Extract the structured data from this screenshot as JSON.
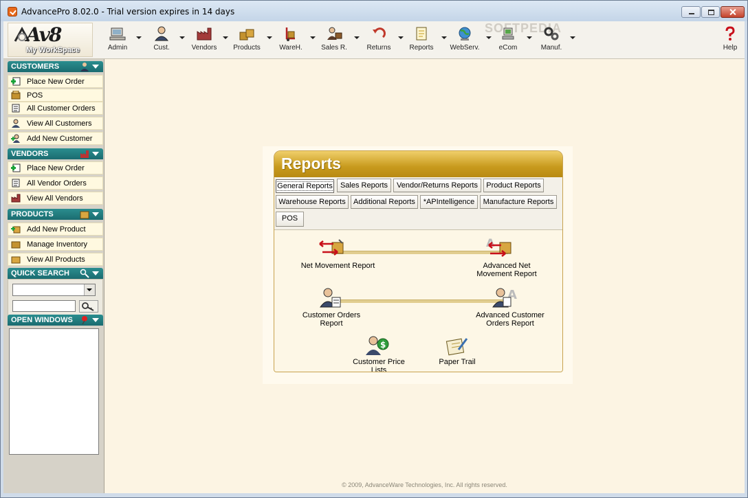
{
  "window": {
    "title": "AdvancePro 8.02.0 - Trial version expires in 14 days"
  },
  "logo": {
    "mark": "Av8",
    "subtitle": "My WorkSpace"
  },
  "toolbar": {
    "items": [
      {
        "label": "Admin",
        "icon": "admin-computer-icon"
      },
      {
        "label": "Cust.",
        "icon": "customer-person-icon"
      },
      {
        "label": "Vendors",
        "icon": "vendors-factory-icon"
      },
      {
        "label": "Products",
        "icon": "products-boxes-icon"
      },
      {
        "label": "WareH.",
        "icon": "warehouse-handtruck-icon"
      },
      {
        "label": "Sales R.",
        "icon": "sales-rep-icon"
      },
      {
        "label": "Returns",
        "icon": "returns-arrow-icon"
      },
      {
        "label": "Reports",
        "icon": "reports-document-icon"
      },
      {
        "label": "WebServ.",
        "icon": "webserv-globe-icon"
      },
      {
        "label": "eCom",
        "icon": "ecom-cart-icon"
      },
      {
        "label": "Manuf.",
        "icon": "manufacture-gears-icon"
      }
    ],
    "help_label": "Help",
    "watermark": "SOFTPEDIA"
  },
  "sidebar": {
    "customers": {
      "header": "CUSTOMERS",
      "items": [
        "Place New Order",
        "POS",
        "All Customer Orders",
        "View All Customers",
        "Add New Customer"
      ]
    },
    "vendors": {
      "header": "VENDORS",
      "items": [
        "Place New Order",
        "All Vendor Orders",
        "View All Vendors"
      ]
    },
    "products": {
      "header": "PRODUCTS",
      "items": [
        "Add New Product",
        "Manage Inventory",
        "View All Products"
      ]
    },
    "quick_search": {
      "header": "QUICK SEARCH",
      "select_value": "",
      "input_value": ""
    },
    "open_windows": {
      "header": "OPEN WINDOWS"
    }
  },
  "reports": {
    "title": "Reports",
    "tabs_row1": [
      "General Reports",
      "Sales Reports",
      "Vendor/Returns Reports",
      "Product Reports"
    ],
    "tabs_row2": [
      "Warehouse Reports",
      "Additional Reports",
      "*APIntelligence",
      "Manufacture Reports"
    ],
    "tabs_row3": [
      "POS"
    ],
    "active_tab": "General Reports",
    "items": {
      "net_movement": "Net Movement Report",
      "advanced_net_movement_1": "Advanced Net",
      "advanced_net_movement_2": "Movement Report",
      "customer_orders_1": "Customer Orders",
      "customer_orders_2": "Report",
      "advanced_customer_orders_1": "Advanced Customer",
      "advanced_customer_orders_2": "Orders Report",
      "customer_price_lists_1": "Customer Price",
      "customer_price_lists_2": "Lists",
      "paper_trail": "Paper Trail"
    }
  },
  "footer": {
    "copyright": "© 2009, AdvanceWare Technologies, Inc. All rights reserved."
  },
  "colors": {
    "sidebar_header": "#1b6c70",
    "sidebar_item_bg": "#fff9e0",
    "reports_header": "#c89a1d",
    "main_bg": "#fcf4e3"
  }
}
